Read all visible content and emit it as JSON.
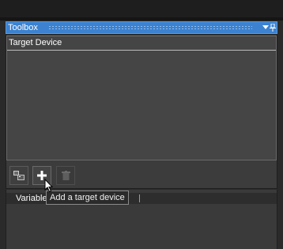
{
  "toolbox": {
    "title": "Toolbox",
    "title_bar_color": "#3c82d0",
    "buttons": [
      {
        "name": "dropdown",
        "icon": "triangle-down-icon"
      },
      {
        "name": "pin",
        "icon": "pin-icon"
      }
    ]
  },
  "target_device": {
    "header": "Target Device",
    "items": []
  },
  "toolbar": {
    "buttons": [
      {
        "icon": "device-settings-icon",
        "enabled": true
      },
      {
        "icon": "plus-icon",
        "enabled": true
      },
      {
        "icon": "trash-icon",
        "enabled": false
      }
    ]
  },
  "variables": {
    "header": "Variable"
  },
  "tooltip": {
    "text": "Add a target device"
  }
}
